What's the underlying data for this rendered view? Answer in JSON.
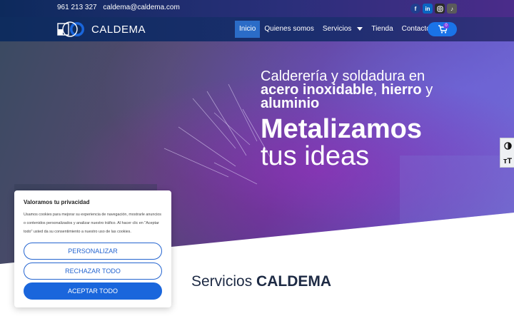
{
  "topbar": {
    "phone": "961 213 327",
    "email": "caldema@caldema.com",
    "socials": [
      "facebook-icon",
      "linkedin-icon",
      "instagram-icon",
      "tiktok-icon"
    ]
  },
  "nav": {
    "brand": "CALDEMA",
    "items": [
      {
        "label": "Inicio",
        "active": true
      },
      {
        "label": "Quienes somos",
        "active": false
      },
      {
        "label": "Servicios",
        "active": false,
        "has_dropdown": true
      },
      {
        "label": "Tienda",
        "active": false
      },
      {
        "label": "Contacto",
        "active": false
      }
    ],
    "cart_count": "0"
  },
  "hero": {
    "line1": "Calderería y soldadura en",
    "line2_bold_a": "acero inoxidable",
    "line2_sep": ", ",
    "line2_bold_b": "hierro",
    "line2_tail": " y",
    "line3": "aluminio",
    "headline_1": "Metalizamos",
    "headline_2": "tus ideas"
  },
  "accessibility": {
    "contrast_icon": "contrast-icon",
    "text_size_label": "ᴛT"
  },
  "services": {
    "prefix": "Servicios ",
    "brand": "CALDEMA"
  },
  "cookie": {
    "title": "Valoramos tu privacidad",
    "description": "Usamos cookies para mejorar su experiencia de navegación, mostrarle anuncios o contenidos personalizados y analizar nuestro tráfico. Al hacer clic en \"Aceptar todo\" usted da su consentimiento a nuestro uso de las cookies.",
    "customize": "PERSONALIZAR",
    "reject": "RECHAZAR TODO",
    "accept": "ACEPTAR TODO"
  },
  "colors": {
    "accent": "#1a66dc",
    "nav_active": "#2b6cc7",
    "heading_dark": "#1d2a44"
  }
}
